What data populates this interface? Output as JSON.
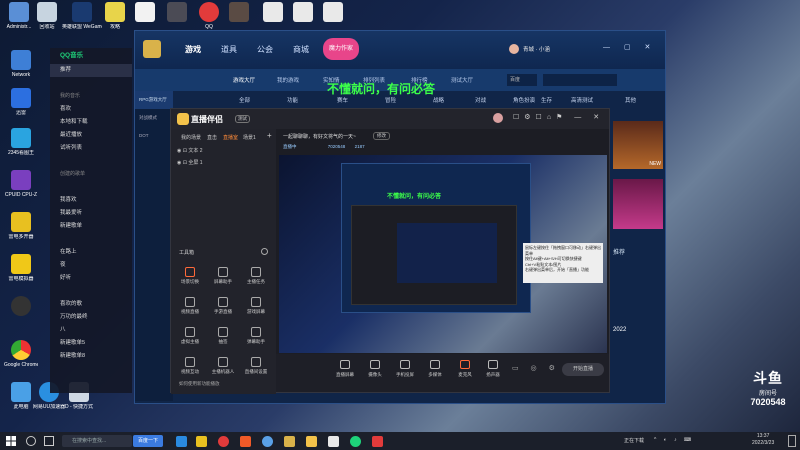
{
  "desktop": {
    "top_icons": [
      "Administr...",
      "回收站",
      "英雄联盟 WeGame版",
      "攻略",
      "",
      "",
      "QQ",
      "",
      "",
      "",
      ""
    ],
    "left_icons": [
      "Network",
      "迅雷",
      "2345看图王",
      "CPUID CPU-Z",
      "雷电多开器",
      "雷电模拟器",
      "",
      "Google Chrome",
      "此电脑",
      "网易UU加速器",
      "D - 快捷方式"
    ]
  },
  "qq_music": {
    "title": "QQ音乐",
    "items": [
      "推荐",
      "",
      "我的音乐",
      "喜欢",
      "本地和下载",
      "最近播放",
      "试听列表",
      "",
      "创建的歌单",
      "",
      "我喜欢",
      "我最爱听",
      "新建歌单",
      "",
      "在路上",
      "夜",
      "好听",
      "",
      "喜欢的歌",
      "万功的最终",
      "八",
      "新建歌单5",
      "新建歌单8"
    ]
  },
  "game_window": {
    "nav": [
      "游戏",
      "道具",
      "公会",
      "商城"
    ],
    "badge": "魔力作家",
    "user": "青城 · 小涵",
    "sub_tabs": [
      "游戏大厅",
      "我的游戏",
      "实知情",
      "排列列表",
      "排行榜",
      "测试大厅"
    ],
    "sub_select": "百度",
    "left_items": [
      "RPG游戏大厅",
      "对战模式",
      "DOT"
    ],
    "categories": [
      "全部",
      "功能",
      "赛车",
      "冒险",
      "战略",
      "对战",
      "角色扮演",
      "生存",
      "高清测试",
      "其他"
    ],
    "subtitle": "不懂就问，有问必答",
    "right_items": [
      "NEW",
      "推荐",
      "2022"
    ]
  },
  "stream_app": {
    "title": "直播伴侣",
    "version": "测试",
    "tabs": [
      "我的场景",
      "直击",
      "直播室",
      "场景1"
    ],
    "scenes": [
      "文本 2",
      "全屏 1"
    ],
    "toolbar_label": "工具箱",
    "tools": [
      "场景切换",
      "屏幕助手",
      "主播任务",
      "视频直播",
      "手游直播",
      "游戏屏幕",
      "虚拟主播",
      "抽签",
      "弹幕助手",
      "视频互动",
      "主播机器人",
      "直播间设置"
    ],
    "header_note": "一起聊聊聊，有好文将气的一天~",
    "header_btn": "修改",
    "room_label": "直播中",
    "room_id": "7020548",
    "viewers": "2187",
    "bottom": [
      "直播屏幕",
      "摄像头",
      "手机投屏",
      "多媒体",
      "麦克风",
      "扬声器"
    ],
    "start_btn": "开始直播",
    "tip_lines": [
      "鼠标左键按住「拖拽窗口可移动」右键弹出菜单",
      "按住Alt键+Alt+S/H可切换快捷键",
      "Ctrl+V粘贴文本/图片",
      "右键弹出菜单后，开始「直播」功能"
    ],
    "footer_note": "如何使用新功能播放"
  },
  "taskbar": {
    "search_placeholder": "在搜索中查找...",
    "search_btn": "百度一下",
    "tray_text": "正在下载",
    "time": "13:37",
    "date": "2022/3/23"
  },
  "watermark": {
    "brand": "斗鱼",
    "room_label": "房间号",
    "room_number": "7020548"
  }
}
